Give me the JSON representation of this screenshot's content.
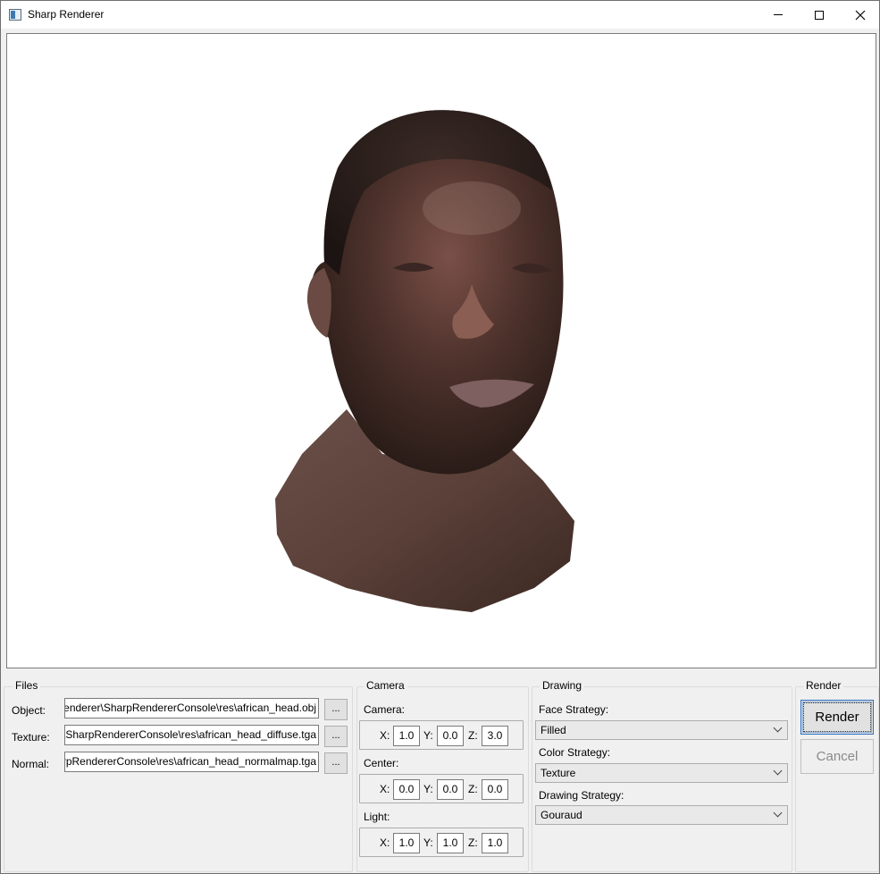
{
  "window": {
    "title": "Sharp Renderer",
    "controls": {
      "minimize": "minimize-icon",
      "maximize": "maximize-icon",
      "close": "close-icon"
    }
  },
  "files": {
    "group_title": "Files",
    "object_label": "Object:",
    "object_value": "Renderer\\SharpRendererConsole\\res\\african_head.obj",
    "texture_label": "Texture:",
    "texture_value": "r\\SharpRendererConsole\\res\\african_head_diffuse.tga",
    "normal_label": "Normal:",
    "normal_value": "arpRendererConsole\\res\\african_head_normalmap.tga",
    "browse_label": "..."
  },
  "camera": {
    "group_title": "Camera",
    "camera_label": "Camera:",
    "center_label": "Center:",
    "light_label": "Light:",
    "x_label": "X:",
    "y_label": "Y:",
    "z_label": "Z:",
    "camera": {
      "x": "1.0",
      "y": "0.0",
      "z": "3.0"
    },
    "center": {
      "x": "0.0",
      "y": "0.0",
      "z": "0.0"
    },
    "light": {
      "x": "1.0",
      "y": "1.0",
      "z": "1.0"
    }
  },
  "drawing": {
    "group_title": "Drawing",
    "face_label": "Face Strategy:",
    "face_value": "Filled",
    "color_label": "Color Strategy:",
    "color_value": "Texture",
    "draw_label": "Drawing Strategy:",
    "draw_value": "Gouraud"
  },
  "render": {
    "group_title": "Render",
    "render_label": "Render",
    "cancel_label": "Cancel"
  },
  "colors": {
    "skin_dark": "#2a1c18",
    "skin_mid": "#5a3c34",
    "skin_light": "#8a6a62",
    "accent": "#2f6fbf"
  }
}
